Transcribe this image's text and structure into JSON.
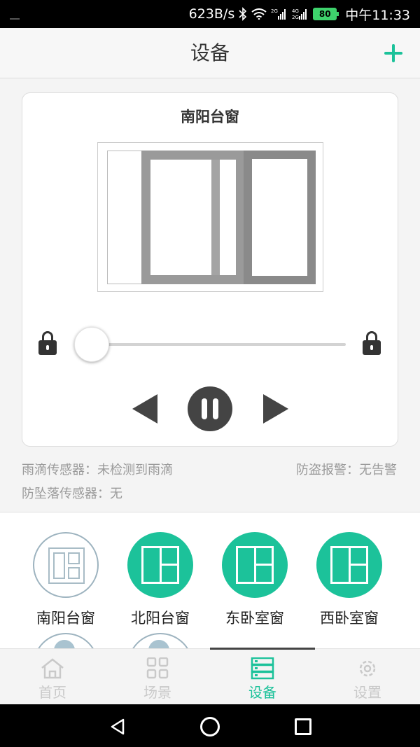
{
  "status_bar": {
    "speed": "623B/s",
    "battery": "80",
    "time": "中午11:33",
    "icons": [
      "bluetooth-icon",
      "wifi-icon",
      "signal-2g-icon",
      "signal-4g-icon",
      "battery-icon"
    ],
    "network_2g": "2G",
    "network_4g": "4G\n2G"
  },
  "header": {
    "title": "设备",
    "add_icon": "plus-icon"
  },
  "card": {
    "title": "南阳台窗",
    "slider": {
      "position": 0.0,
      "left_icon": "lock-icon",
      "right_icon": "lock-icon"
    },
    "controls": {
      "prev": "prev-icon",
      "pause": "pause-icon",
      "next": "next-icon"
    }
  },
  "sensors": {
    "rain": "雨滴传感器：未检测到雨滴",
    "alarm": "防盗报警：无告警",
    "fall": "防坠落传感器：无"
  },
  "devices": [
    {
      "label": "南阳台窗",
      "state": "inactive"
    },
    {
      "label": "北阳台窗",
      "state": "active"
    },
    {
      "label": "东卧室窗",
      "state": "active"
    },
    {
      "label": "西卧室窗",
      "state": "active"
    }
  ],
  "tabs": [
    {
      "label": "首页",
      "icon": "home-icon",
      "active": false
    },
    {
      "label": "场景",
      "icon": "grid-icon",
      "active": false
    },
    {
      "label": "设备",
      "icon": "server-icon",
      "active": true
    },
    {
      "label": "设置",
      "icon": "gear-icon",
      "active": false
    }
  ],
  "colors": {
    "accent": "#1cc29a",
    "dark": "#444444",
    "muted": "#9a9a9a"
  }
}
